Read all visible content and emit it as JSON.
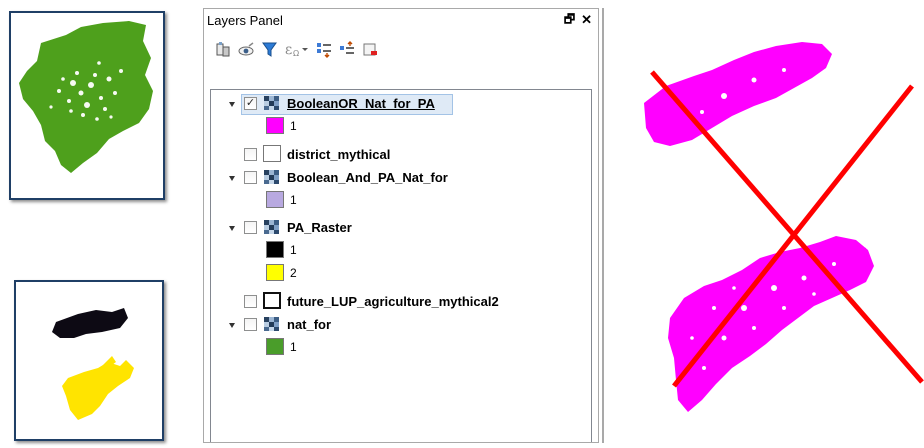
{
  "panel": {
    "title": "Layers Panel",
    "undock_glyph": "🗗",
    "close_glyph": "✕"
  },
  "toolbar": {
    "icons": [
      "style-manager-icon",
      "toggle-visibility-icon",
      "filter-legend-icon",
      "filter-expression-icon",
      "expand-all-icon",
      "collapse-all-icon",
      "remove-layer-icon"
    ]
  },
  "layers": [
    {
      "name": "BooleanOR_Nat_for_PA",
      "checked": true,
      "selected": true,
      "expanded": true,
      "classes": [
        {
          "label": "1",
          "color": "#ff00ff"
        }
      ]
    },
    {
      "name": "district_mythical",
      "checked": false,
      "selected": false,
      "expanded": false,
      "classes": []
    },
    {
      "name": "Boolean_And_PA_Nat_for",
      "checked": false,
      "selected": false,
      "expanded": true,
      "classes": [
        {
          "label": "1",
          "color": "#b8a9e0"
        }
      ]
    },
    {
      "name": "PA_Raster",
      "checked": false,
      "selected": false,
      "expanded": true,
      "classes": [
        {
          "label": "1",
          "color": "#000000"
        },
        {
          "label": "2",
          "color": "#ffff00"
        }
      ]
    },
    {
      "name": "future_LUP_agriculture_mythical2",
      "checked": false,
      "selected": false,
      "expanded": false,
      "classes": []
    },
    {
      "name": "nat_for",
      "checked": false,
      "selected": false,
      "expanded": true,
      "classes": [
        {
          "label": "1",
          "color": "#4a9d2a"
        }
      ]
    }
  ],
  "check_glyph": "✓",
  "colors": {
    "forest_green": "#4ea01c",
    "pa_black": "#0d0a14",
    "pa_yellow": "#ffe400",
    "magenta": "#ff00ff",
    "cross_red": "#ff0000",
    "thumb_border": "#1f3f66"
  }
}
